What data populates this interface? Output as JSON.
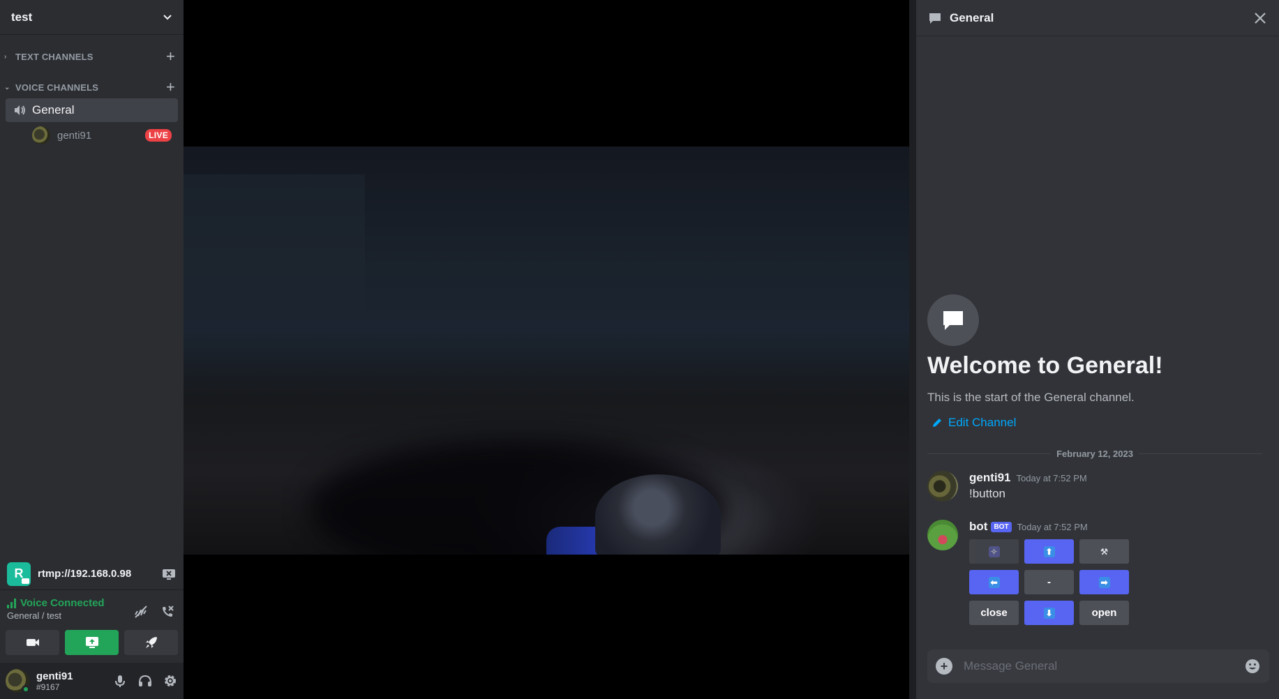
{
  "server": {
    "name": "test"
  },
  "categories": {
    "text": "TEXT CHANNELS",
    "voice": "VOICE CHANNELS"
  },
  "voice_channel": {
    "name": "General"
  },
  "voice_user": {
    "name": "genti91",
    "badge": "LIVE"
  },
  "stream_source": {
    "letter": "R",
    "label": "rtmp://192.168.0.98"
  },
  "voice_status": {
    "title": "Voice Connected",
    "location": "General / test"
  },
  "user": {
    "name": "genti91",
    "tag": "#9167"
  },
  "chat": {
    "header": "General",
    "welcome_title": "Welcome to General!",
    "welcome_sub": "This is the start of the General channel.",
    "edit_channel": "Edit Channel",
    "date": "February 12, 2023",
    "composer_placeholder": "Message General",
    "messages": [
      {
        "author": "genti91",
        "time": "Today at 7:52 PM",
        "text": "!button"
      },
      {
        "author": "bot",
        "tag": "BOT",
        "time": "Today at 7:52 PM"
      }
    ],
    "buttons": [
      {
        "label": "",
        "icon": "sparkle-icon",
        "style": "grey"
      },
      {
        "label": "⬆",
        "icon": "arrow-up-icon",
        "style": "blue"
      },
      {
        "label": "",
        "icon": "wand-icon",
        "style": "grey"
      },
      {
        "label": "⬅",
        "icon": "arrow-left-icon",
        "style": "blue"
      },
      {
        "label": "-",
        "icon": "",
        "style": "grey"
      },
      {
        "label": "➡",
        "icon": "arrow-right-icon",
        "style": "blue"
      },
      {
        "label": "close",
        "icon": "",
        "style": "grey"
      },
      {
        "label": "⬇",
        "icon": "arrow-down-icon",
        "style": "blue"
      },
      {
        "label": "open",
        "icon": "",
        "style": "grey"
      }
    ]
  },
  "colors": {
    "accent": "#5865f2",
    "live": "#ed4245",
    "online": "#23a559",
    "link": "#00a8fc"
  }
}
